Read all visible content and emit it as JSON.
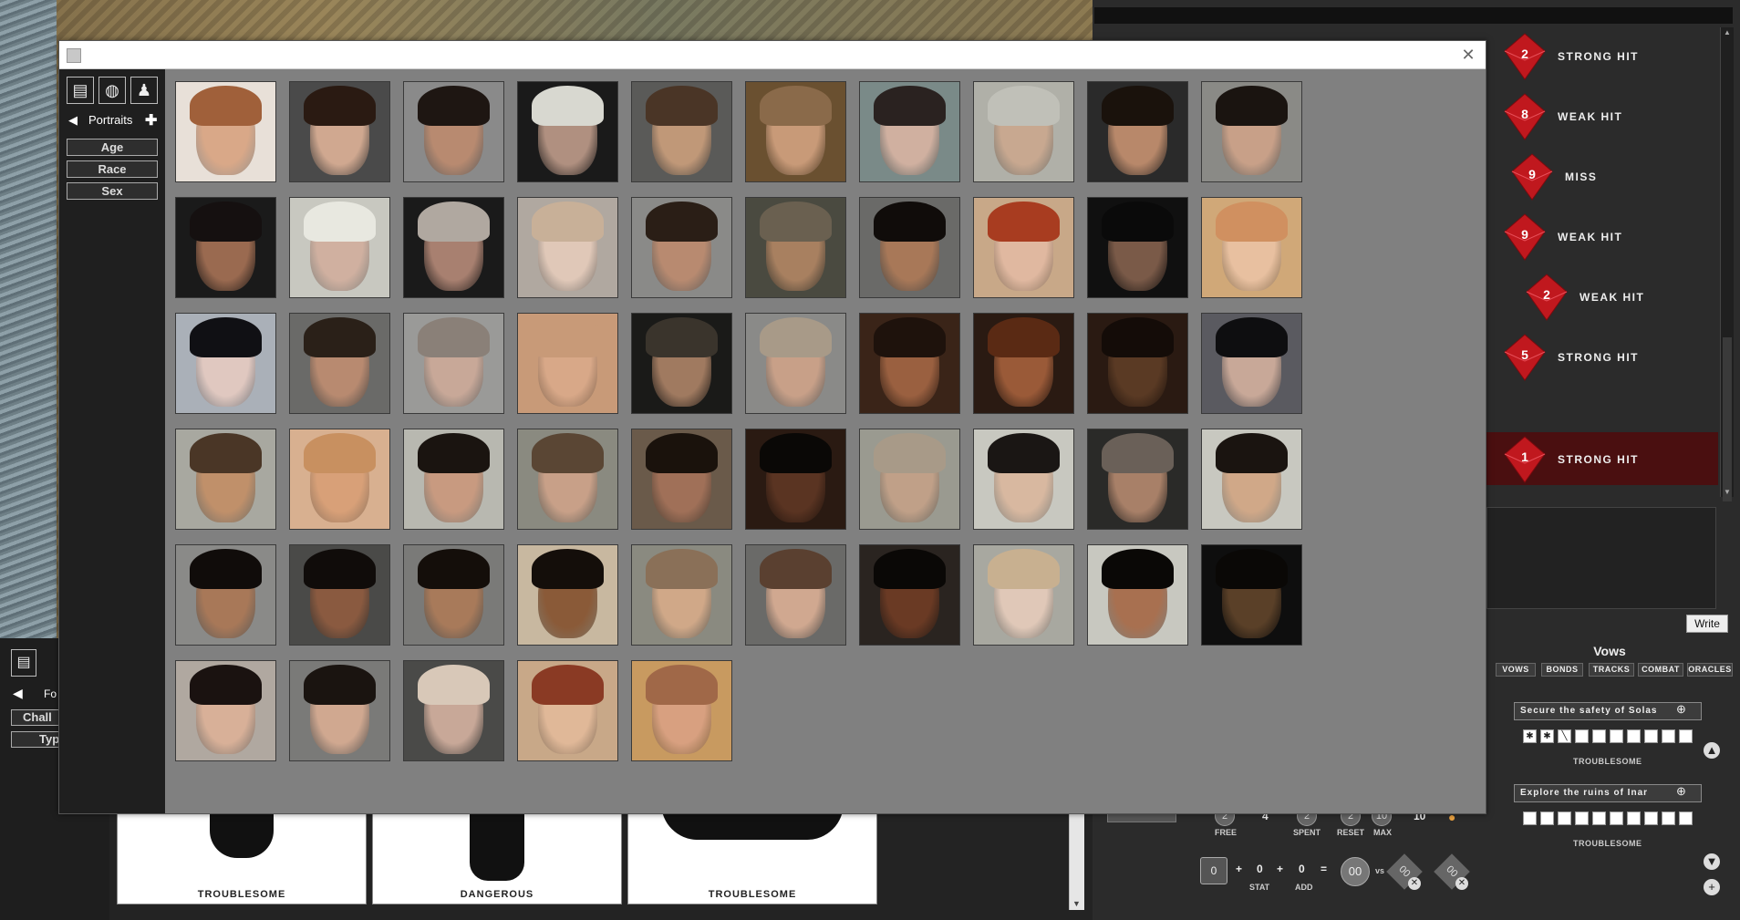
{
  "background": {
    "cards": [
      {
        "label": "TROUBLESOME"
      },
      {
        "label": "DANGEROUS"
      },
      {
        "label": "TROUBLESOME"
      }
    ],
    "left_panel": {
      "nav_label": "Fo",
      "filters": [
        "Chall",
        "Typ"
      ]
    }
  },
  "dice_rolls": [
    {
      "value": "2",
      "result": "STRONG HIT"
    },
    {
      "value": "8",
      "result": "WEAK HIT"
    },
    {
      "value": "9",
      "result": "MISS"
    },
    {
      "value": "9",
      "result": "WEAK HIT"
    },
    {
      "value": "2",
      "result": "WEAK HIT"
    },
    {
      "value": "5",
      "result": "STRONG HIT"
    },
    {
      "value": "1",
      "result": "STRONG HIT"
    }
  ],
  "journal": {
    "write_label": "Write"
  },
  "vows": {
    "title": "Vows",
    "tabs": [
      "VOWS",
      "BONDS",
      "TRACKS",
      "COMBAT",
      "ORACLES"
    ],
    "items": [
      {
        "name": "Secure the safety of Solas",
        "rank": "TROUBLESOME",
        "progress_marks": [
          "✱",
          "✱",
          "╲",
          "",
          "",
          "",
          "",
          "",
          "",
          ""
        ]
      },
      {
        "name": "Explore the ruins of Inar",
        "rank": "TROUBLESOME",
        "progress_marks": [
          "",
          "",
          "",
          "",
          "",
          "",
          "",
          "",
          "",
          ""
        ]
      }
    ]
  },
  "momentum": {
    "free_label": "FREE",
    "free": "2",
    "spent_label": "SPENT",
    "spent": "2",
    "reset_label": "RESET",
    "reset": "2",
    "max_label": "MAX",
    "max": "10",
    "value": "4",
    "value2": "10"
  },
  "action_roll": {
    "base": "0",
    "stat_label": "STAT",
    "stat": "0",
    "add_label": "ADD",
    "add": "0",
    "total": "00",
    "vs": "vs",
    "challenge1": "00",
    "challenge2": "00"
  },
  "dialog": {
    "title": "",
    "nav_label": "Portraits",
    "filters": [
      "Age",
      "Race",
      "Sex"
    ],
    "portrait_count": 55,
    "portraits": [
      {
        "bg": "#e8e0d8",
        "skin": "#d9a888",
        "hair": "#a0603a"
      },
      {
        "bg": "#4a4a4a",
        "skin": "#d0a890",
        "hair": "#2a1a12"
      },
      {
        "bg": "#8a8a8a",
        "skin": "#b88a70",
        "hair": "#1e1612"
      },
      {
        "bg": "#1a1a1a",
        "skin": "#b09080",
        "hair": "#d8d8d0"
      },
      {
        "bg": "#5a5a58",
        "skin": "#c09878",
        "hair": "#4a3526"
      },
      {
        "bg": "#6a5030",
        "skin": "#c89a78",
        "hair": "#8a6a4a"
      },
      {
        "bg": "#7a8a88",
        "skin": "#d0b0a0",
        "hair": "#2a2220"
      },
      {
        "bg": "#b0b0a8",
        "skin": "#c8a890",
        "hair": "#c0c0b8"
      },
      {
        "bg": "#2a2a2a",
        "skin": "#b8886a",
        "hair": "#1a120c"
      },
      {
        "bg": "#8a8a86",
        "skin": "#c8a088",
        "hair": "#1a1410"
      },
      {
        "bg": "#1a1a1a",
        "skin": "#9a6a50",
        "hair": "#151010"
      },
      {
        "bg": "#c8c8c0",
        "skin": "#d0b0a0",
        "hair": "#e8e8e0"
      },
      {
        "bg": "#1a1a1a",
        "skin": "#a88070",
        "hair": "#b0a8a0"
      },
      {
        "bg": "#b0a8a0",
        "skin": "#e0c8b8",
        "hair": "#c8b098"
      },
      {
        "bg": "#8a8a88",
        "skin": "#b88a70",
        "hair": "#2a1e16"
      },
      {
        "bg": "#4a4a40",
        "skin": "#a88060",
        "hair": "#6a6050"
      },
      {
        "bg": "#6a6a68",
        "skin": "#a87858",
        "hair": "#100c0a"
      },
      {
        "bg": "#c8a888",
        "skin": "#e0b8a0",
        "hair": "#a83c20"
      },
      {
        "bg": "#101010",
        "skin": "#7a5a48",
        "hair": "#0a0a0a"
      },
      {
        "bg": "#d0a878",
        "skin": "#e8c0a0",
        "hair": "#d09060"
      },
      {
        "bg": "#aab0b8",
        "skin": "#e0c8c0",
        "hair": "#101014"
      },
      {
        "bg": "#6a6a68",
        "skin": "#b88a70",
        "hair": "#2a2018"
      },
      {
        "bg": "#9a9a98",
        "skin": "#c8a898",
        "hair": "#8a8078"
      },
      {
        "bg": "#c89a78",
        "skin": "#d8a888",
        "hair": "#c89a78"
      },
      {
        "bg": "#1a1a18",
        "skin": "#a07a60",
        "hair": "#3a342c"
      },
      {
        "bg": "#8a8a88",
        "skin": "#c8a088",
        "hair": "#a89a88"
      },
      {
        "bg": "#3a2418",
        "skin": "#9a6040",
        "hair": "#1e120c"
      },
      {
        "bg": "#2a1a12",
        "skin": "#9a5a38",
        "hair": "#5a2a14"
      },
      {
        "bg": "#2a1a12",
        "skin": "#5a3a24",
        "hair": "#140c08"
      },
      {
        "bg": "#5a5a60",
        "skin": "#c8a898",
        "hair": "#0e0e10"
      },
      {
        "bg": "#a8a8a0",
        "skin": "#c0906a",
        "hair": "#4a3626"
      },
      {
        "bg": "#d8b090",
        "skin": "#d8a078",
        "hair": "#c89060"
      },
      {
        "bg": "#b8b8b0",
        "skin": "#c89a80",
        "hair": "#1a1410"
      },
      {
        "bg": "#8a8a80",
        "skin": "#c8a088",
        "hair": "#5a4634"
      },
      {
        "bg": "#6a5a4a",
        "skin": "#a07058",
        "hair": "#1a120c"
      },
      {
        "bg": "#2a1a12",
        "skin": "#5a3422",
        "hair": "#0a0806"
      },
      {
        "bg": "#9a9a90",
        "skin": "#c0a088",
        "hair": "#a89a88"
      },
      {
        "bg": "#c8c8c0",
        "skin": "#d8b8a0",
        "hair": "#1a1614"
      },
      {
        "bg": "#2a2a28",
        "skin": "#a88068",
        "hair": "#6a6058"
      },
      {
        "bg": "#c8c8c0",
        "skin": "#d0a888",
        "hair": "#1a1410"
      },
      {
        "bg": "#8a8a88",
        "skin": "#a87858",
        "hair": "#100c0a"
      },
      {
        "bg": "#4a4a48",
        "skin": "#8a5a40",
        "hair": "#100c0a"
      },
      {
        "bg": "#7a7a78",
        "skin": "#a87a5a",
        "hair": "#140e0a"
      },
      {
        "bg": "#c8b8a0",
        "skin": "#8a5a38",
        "hair": "#140e0a"
      },
      {
        "bg": "#8a8a80",
        "skin": "#d0a888",
        "hair": "#8a7058"
      },
      {
        "bg": "#6a6a68",
        "skin": "#d0a890",
        "hair": "#5a4030"
      },
      {
        "bg": "#2a2420",
        "skin": "#6a3a24",
        "hair": "#0a0806"
      },
      {
        "bg": "#a8a8a0",
        "skin": "#e0c8b8",
        "hair": "#c8b090"
      },
      {
        "bg": "#c8c8c0",
        "skin": "#a87050",
        "hair": "#0a0806"
      },
      {
        "bg": "#0e0e0e",
        "skin": "#5a4028",
        "hair": "#0a0806"
      },
      {
        "bg": "#b0a8a0",
        "skin": "#d8b098",
        "hair": "#1a1210"
      },
      {
        "bg": "#7a7a78",
        "skin": "#d0a890",
        "hair": "#1a1410"
      },
      {
        "bg": "#4a4a48",
        "skin": "#c8a898",
        "hair": "#d8c8b8"
      },
      {
        "bg": "#c8a888",
        "skin": "#e0b898",
        "hair": "#8a3a24"
      },
      {
        "bg": "#c89a60",
        "skin": "#d8a080",
        "hair": "#a06848"
      }
    ]
  }
}
